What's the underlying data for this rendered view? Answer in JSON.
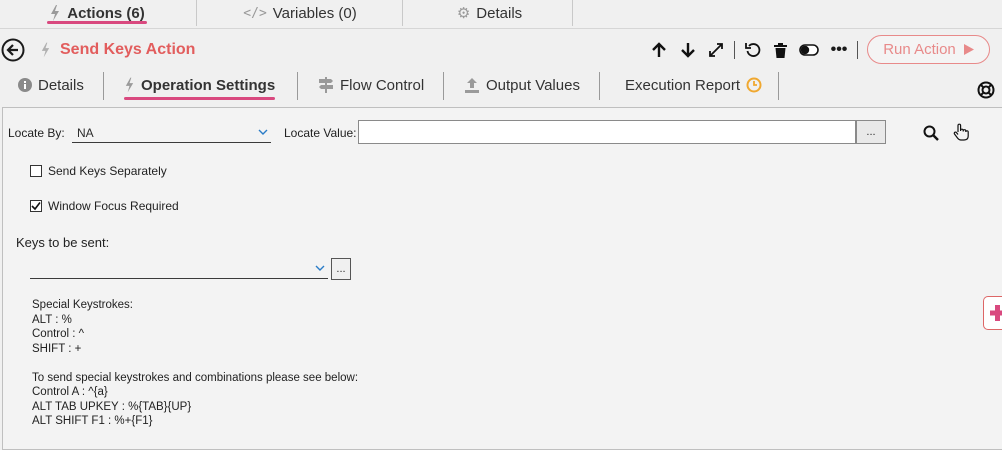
{
  "top_tabs": {
    "actions": "Actions (6)",
    "variables": "Variables (0)",
    "details": "Details"
  },
  "header": {
    "title": "Send Keys Action",
    "run_label": "Run Action"
  },
  "sub_tabs": {
    "details": "Details",
    "operation_settings": "Operation Settings",
    "flow_control": "Flow Control",
    "output_values": "Output Values",
    "execution_report": "Execution Report"
  },
  "form": {
    "locate_by_label": "Locate By:",
    "locate_by_value": "NA",
    "locate_value_label": "Locate Value:",
    "locate_value": "",
    "ellipsis": "...",
    "send_keys_separately": "Send Keys Separately",
    "send_keys_separately_checked": false,
    "window_focus_required": "Window Focus Required",
    "window_focus_required_checked": true,
    "keys_label": "Keys to be sent:",
    "keys_value": ""
  },
  "help": {
    "special_title": "Special Keystrokes:",
    "alt": "ALT : %",
    "control": "Control : ^",
    "shift": "SHIFT : +",
    "combo_intro": "To send special keystrokes and combinations please see below:",
    "control_a": "Control A : ^{a}",
    "alt_tab_upkey": "ALT TAB UPKEY : %{TAB}{UP}",
    "alt_shift_f1": "ALT SHIFT F1 : %+{F1}"
  },
  "colors": {
    "accent": "#d9497f",
    "title": "#e25d5d",
    "run": "#e88a8a"
  }
}
